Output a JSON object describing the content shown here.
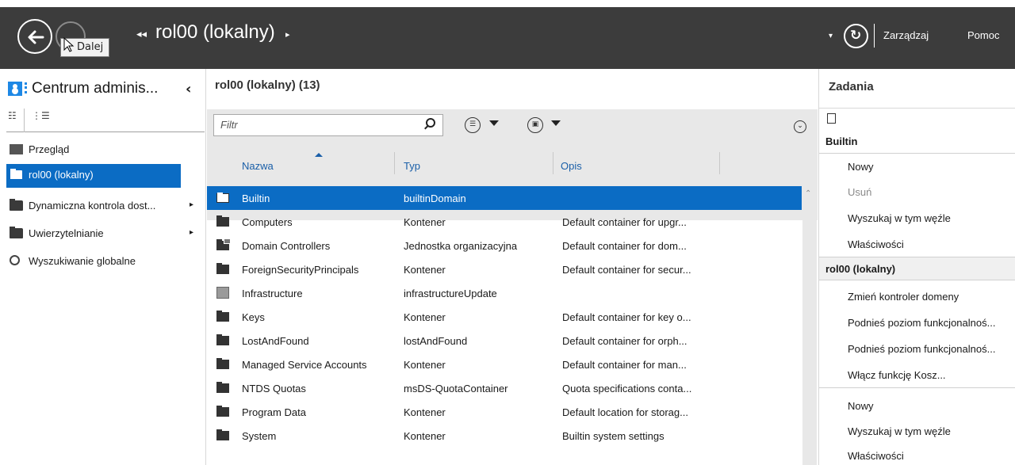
{
  "topbar": {
    "tooltip": "Dalej",
    "breadcrumb_back": "◂◂",
    "breadcrumb": "rol00 (lokalny)",
    "breadcrumb_fwd": "▸",
    "refresh_drop": "▾",
    "manage": "Zarządzaj",
    "help": "Pomoc"
  },
  "left": {
    "title": "Centrum adminis...",
    "collapse": "‹",
    "items": [
      {
        "label": "Przegląd"
      },
      {
        "label": "rol00 (lokalny)",
        "arrow": "▸"
      },
      {
        "label": "Dynamiczna kontrola dost...",
        "arrow": "▸"
      },
      {
        "label": "Uwierzytelnianie",
        "arrow": "▸"
      },
      {
        "label": "Wyszukiwanie globalne"
      }
    ]
  },
  "center": {
    "title": "rol00 (lokalny)  (13)",
    "filter_placeholder": "Filtr",
    "columns": [
      "Nazwa",
      "Typ",
      "Opis"
    ],
    "rows": [
      {
        "name": "Builtin",
        "type": "builtinDomain",
        "desc": "",
        "icon": "folder-icon"
      },
      {
        "name": "Computers",
        "type": "Kontener",
        "desc": "Default container for upgr...",
        "icon": "folder-icon"
      },
      {
        "name": "Domain Controllers",
        "type": "Jednostka organizacyjna",
        "desc": "Default container for dom...",
        "icon": "ou-icon"
      },
      {
        "name": "ForeignSecurityPrincipals",
        "type": "Kontener",
        "desc": "Default container for secur...",
        "icon": "folder-icon"
      },
      {
        "name": "Infrastructure",
        "type": "infrastructureUpdate",
        "desc": "",
        "icon": "infrastructure-icon"
      },
      {
        "name": "Keys",
        "type": "Kontener",
        "desc": "Default container for key o...",
        "icon": "folder-icon"
      },
      {
        "name": "LostAndFound",
        "type": "lostAndFound",
        "desc": "Default container for orph...",
        "icon": "folder-icon"
      },
      {
        "name": "Managed Service Accounts",
        "type": "Kontener",
        "desc": "Default container for man...",
        "icon": "folder-icon"
      },
      {
        "name": "NTDS Quotas",
        "type": "msDS-QuotaContainer",
        "desc": "Quota specifications conta...",
        "icon": "folder-icon"
      },
      {
        "name": "Program Data",
        "type": "Kontener",
        "desc": "Default location for storag...",
        "icon": "folder-icon"
      },
      {
        "name": "System",
        "type": "Kontener",
        "desc": "Builtin system settings",
        "icon": "folder-icon"
      }
    ]
  },
  "right": {
    "title": "Zadania",
    "sections": [
      {
        "header": "Builtin",
        "tasks": [
          {
            "label": "Nowy",
            "enabled": true
          },
          {
            "label": "Usuń",
            "enabled": false
          },
          {
            "label": "Wyszukaj w tym węźle",
            "enabled": true
          },
          {
            "label": "Właściwości",
            "enabled": true
          }
        ]
      },
      {
        "header": "rol00 (lokalny)",
        "tasks": [
          {
            "label": "Zmień kontroler domeny",
            "enabled": true
          },
          {
            "label": "Podnieś poziom funkcjonalnoś...",
            "enabled": true
          },
          {
            "label": "Podnieś poziom funkcjonalnoś...",
            "enabled": true
          },
          {
            "label": "Włącz funkcję Kosz...",
            "enabled": true
          },
          {
            "label": "Nowy",
            "enabled": true
          },
          {
            "label": "Wyszukaj w tym węźle",
            "enabled": true
          },
          {
            "label": "Właściwości",
            "enabled": true
          }
        ]
      }
    ]
  },
  "colors": {
    "accent": "#0b6cc4",
    "topbar": "#3c3c3c",
    "link": "#1a5fa8"
  }
}
